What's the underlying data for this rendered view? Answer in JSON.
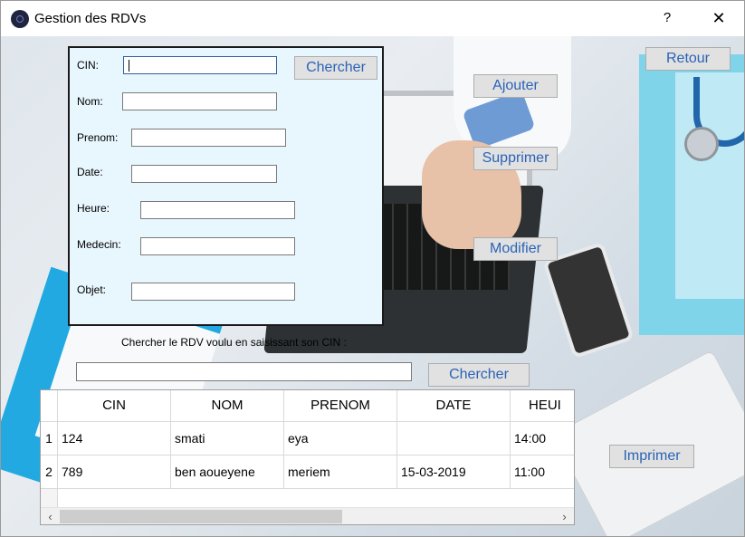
{
  "window": {
    "title": "Gestion des RDVs",
    "help": "?",
    "close": "✕"
  },
  "form": {
    "cin_label": "CIN:",
    "nom_label": "Nom:",
    "prenom_label": "Prenom:",
    "date_label": "Date:",
    "heure_label": "Heure:",
    "medecin_label": "Medecin:",
    "objet_label": "Objet:",
    "cin_value": "",
    "nom_value": "",
    "prenom_value": "",
    "date_value": "",
    "heure_value": "",
    "medecin_value": "",
    "objet_value": "",
    "search_button": "Chercher"
  },
  "actions": {
    "retour": "Retour",
    "ajouter": "Ajouter",
    "supprimer": "Supprimer",
    "modifier": "Modifier",
    "imprimer": "Imprimer"
  },
  "search": {
    "hint": "Chercher le RDV voulu en saisissant son CIN :",
    "value": "",
    "button": "Chercher"
  },
  "table": {
    "columns": [
      "CIN",
      "NOM",
      "PRENOM",
      "DATE",
      "HEUI"
    ],
    "rows": [
      {
        "index": "1",
        "cells": [
          "124",
          "smati",
          "eya",
          "",
          "14:00"
        ]
      },
      {
        "index": "2",
        "cells": [
          "789",
          "ben  aoueyene",
          "meriem",
          "15-03-2019",
          "11:00"
        ]
      }
    ],
    "scroll_left": "‹",
    "scroll_right": "›"
  }
}
